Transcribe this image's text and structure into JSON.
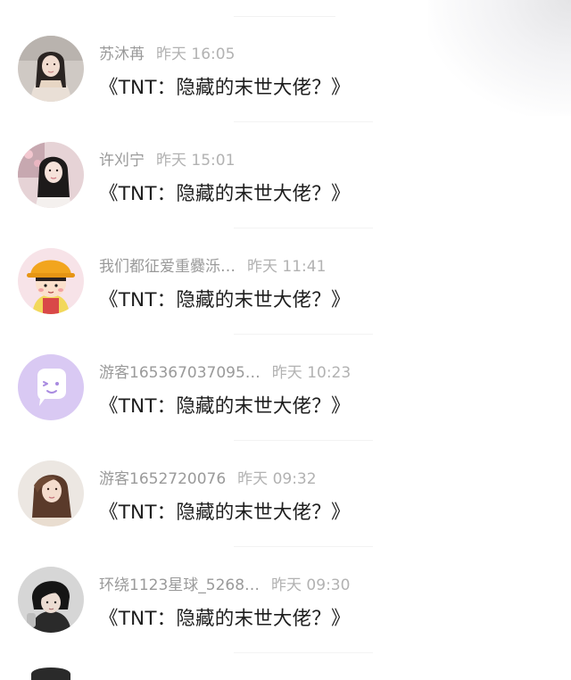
{
  "messages": [
    {
      "name": "苏沐苒",
      "time": "昨天 16:05",
      "text": "《TNT：隐藏的末世大佬？》",
      "avatar": "woman-portrait-light-avatar"
    },
    {
      "name": "许刈宁",
      "time": "昨天 15:01",
      "text": "《TNT：隐藏的末世大佬？》",
      "avatar": "girl-selfie-avatar"
    },
    {
      "name": "我们都征爱重爨泺…",
      "time": "昨天 11:41",
      "text": "《TNT：隐藏的末世大佬？》",
      "avatar": "cartoon-girl-yellow-hat-avatar"
    },
    {
      "name": "游客165367037095…",
      "time": "昨天 10:23",
      "text": "《TNT：隐藏的末世大佬？》",
      "avatar": "purple-chat-bubble-default-avatar"
    },
    {
      "name": "游客1652720076",
      "time": "昨天 09:32",
      "text": "《TNT：隐藏的末世大佬？》",
      "avatar": "woman-portrait-avatar"
    },
    {
      "name": "环绕1123星球_5268…",
      "time": "昨天 09:30",
      "text": "《TNT：隐藏的末世大佬？》",
      "avatar": "dark-hair-boy-avatar"
    }
  ],
  "colors": {
    "name": "#9a9a9a",
    "time": "#b2b2b2",
    "message": "#1e1e1e",
    "default_avatar_bg": "#d9c9f3",
    "background": "#ffffff"
  }
}
